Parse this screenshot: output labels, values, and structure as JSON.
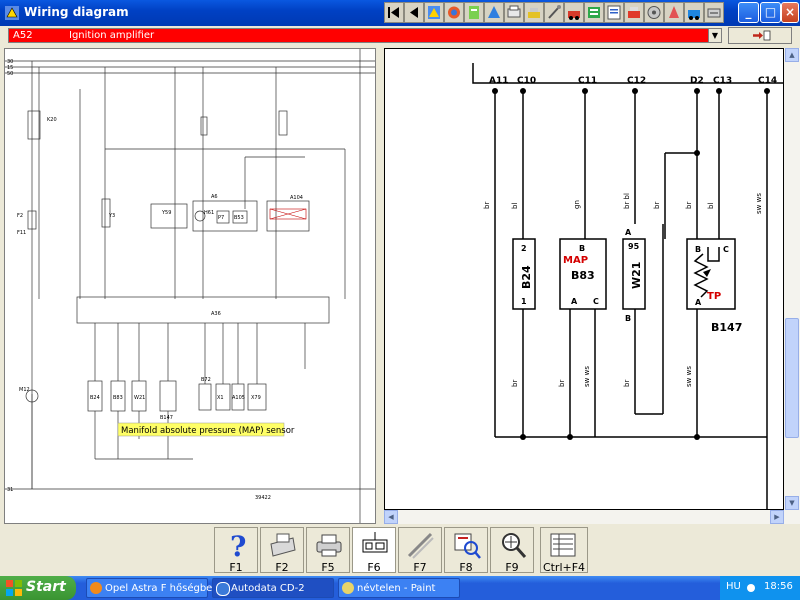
{
  "window": {
    "title": "Wiring diagram",
    "minimize": "_",
    "maximize": "□",
    "close": "×"
  },
  "component_selector": {
    "code": "A52",
    "name": "Ignition amplifier"
  },
  "left_schematic": {
    "bus_labels": [
      "30",
      "15",
      "50"
    ],
    "ground_label": "31",
    "diagram_number": "39422",
    "component_labels": [
      "K20",
      "F1",
      "F2",
      "F2",
      "F11",
      "Y3",
      "Y59",
      "A6",
      "H61",
      "P7",
      "B53",
      "A104",
      "A36",
      "M12",
      "B24",
      "B83",
      "W21",
      "B147",
      "B72",
      "X1",
      "A105",
      "X79"
    ],
    "tooltip": "Manifold absolute pressure (MAP) sensor"
  },
  "right_schematic": {
    "pins": [
      "A11",
      "C10",
      "C11",
      "C12",
      "D2",
      "C13",
      "C14"
    ],
    "wire_colors_top": [
      "br",
      "bl",
      "gn",
      "br bl",
      "br",
      "br",
      "bl",
      "sw ws"
    ],
    "wire_colors_bottom": [
      "br",
      "br",
      "sw ws",
      "br",
      "sw ws"
    ],
    "components": [
      {
        "id": "B24",
        "pin_top": "2",
        "pin_bottom": "1"
      },
      {
        "id": "B83",
        "label": "MAP",
        "pin_top": "B",
        "pin_bl": "A",
        "pin_br": "C"
      },
      {
        "id": "W21",
        "pin_top": "95",
        "pin_left_top": "A",
        "pin_left_bottom": "B"
      },
      {
        "id": "B147",
        "label": "TP",
        "pin_tl": "B",
        "pin_tr": "C",
        "pin_bottom": "A"
      }
    ]
  },
  "function_keys": [
    {
      "label": "F1",
      "icon": "help-icon"
    },
    {
      "label": "F2",
      "icon": "print-preview-icon"
    },
    {
      "label": "F5",
      "icon": "printer-icon"
    },
    {
      "label": "F6",
      "icon": "component-icon"
    },
    {
      "label": "F7",
      "icon": "wires-icon"
    },
    {
      "label": "F8",
      "icon": "locate-icon"
    },
    {
      "label": "F9",
      "icon": "zoom-icon"
    },
    {
      "label": "Ctrl+F4",
      "icon": "list-icon"
    }
  ],
  "taskbar": {
    "start": "Start",
    "tasks": [
      "Opel Astra F hőségbe...",
      "Autodata CD-2",
      "névtelen - Paint"
    ],
    "language": "HU",
    "clock": "18:56"
  },
  "colors": {
    "titlebar": "#0a58e0",
    "selector_bg": "#ff0000",
    "taskbar": "#245edb",
    "start": "#3a9432"
  }
}
